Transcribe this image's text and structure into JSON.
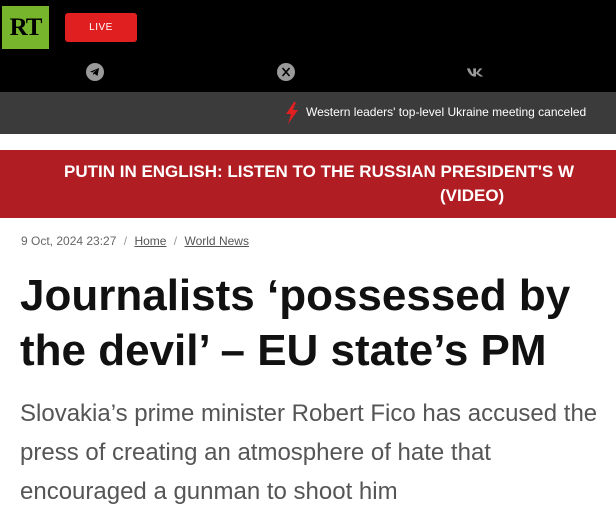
{
  "header": {
    "logo_text": "RT",
    "live_label": "LIVE",
    "social": [
      "telegram-icon",
      "x-icon",
      "vk-icon"
    ],
    "colors": {
      "logo_green": "#77b52c",
      "live_red": "#e02020"
    }
  },
  "ticker": {
    "headline": "Western leaders' top-level Ukraine meeting canceled"
  },
  "banner": {
    "line1": "PUTIN IN ENGLISH: LISTEN TO THE RUSSIAN PRESIDENT'S W",
    "line2": "(VIDEO)",
    "color": "#b01e23"
  },
  "article": {
    "date": "9 Oct, 2024 23:27",
    "breadcrumb": [
      "Home",
      "World News"
    ],
    "title": "Journalists ‘possessed by the devil’ – EU state’s PM",
    "lead": "Slovakia’s prime minister Robert Fico has accused the press of creating an atmosphere of hate that encouraged a gunman to shoot him"
  }
}
